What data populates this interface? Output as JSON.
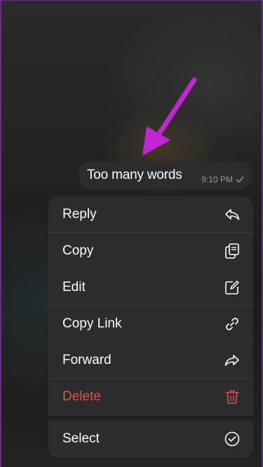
{
  "message": {
    "text": "Too many words",
    "time": "9:10 PM",
    "status_icon": "check-icon"
  },
  "menu": {
    "items": [
      {
        "label": "Reply",
        "icon": "reply-icon"
      },
      {
        "label": "Copy",
        "icon": "copy-icon"
      },
      {
        "label": "Edit",
        "icon": "edit-icon"
      },
      {
        "label": "Copy Link",
        "icon": "link-icon"
      },
      {
        "label": "Forward",
        "icon": "forward-icon"
      },
      {
        "label": "Delete",
        "icon": "trash-icon"
      }
    ],
    "select": {
      "label": "Select",
      "icon": "checkmark-circle-icon"
    }
  },
  "colors": {
    "menu_bg": "#2c2c2e",
    "text": "#ffffff",
    "destructive": "#e0524a",
    "arrow": "#c026d3"
  }
}
